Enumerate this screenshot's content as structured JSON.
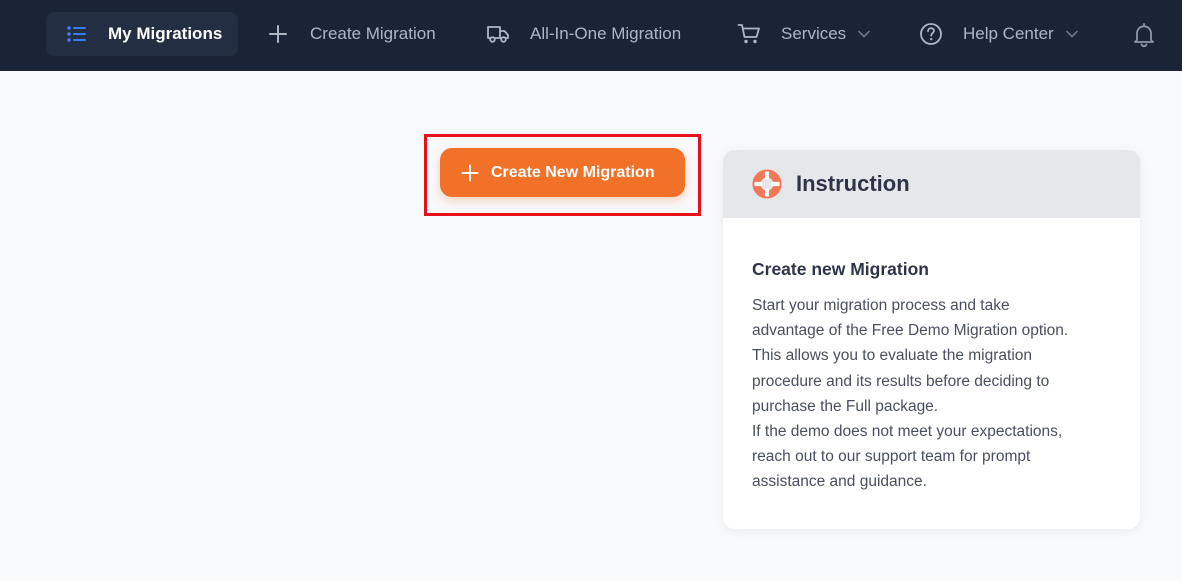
{
  "nav": {
    "my_migrations": "My Migrations",
    "create_migration": "Create Migration",
    "all_in_one": "All-In-One Migration",
    "services": "Services",
    "help_center": "Help Center"
  },
  "icons": {
    "my_migrations": "list-icon",
    "create_migration": "plus-icon",
    "all_in_one": "truck-icon",
    "services": "cart-icon",
    "help_center": "help-circle-icon",
    "notifications": "bell-icon",
    "instruction": "lifebuoy-icon"
  },
  "main": {
    "create_new_button": "Create New Migration"
  },
  "instruction": {
    "title": "Instruction",
    "heading": "Create new Migration",
    "lines": [
      "Start your migration process and take",
      "advantage of the Free Demo Migration option.",
      "This allows you to evaluate the migration",
      "procedure and its results before deciding to",
      "purchase the Full package.",
      "If the demo does not meet your expectations,",
      "reach out to our support team for prompt",
      "assistance and guidance."
    ]
  },
  "colors": {
    "topbar": "#1b2436",
    "accent": "#f07127",
    "active_icon": "#3b7cff",
    "highlight": "#e8101a"
  }
}
